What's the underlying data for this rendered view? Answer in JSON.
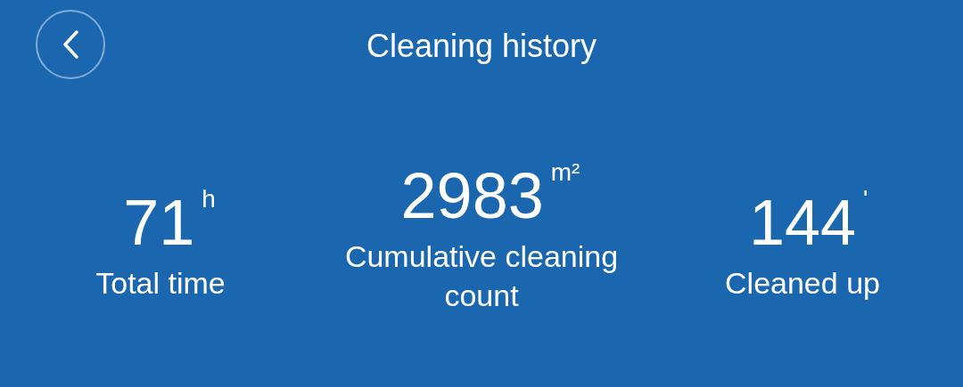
{
  "header": {
    "title": "Cleaning history"
  },
  "stats": [
    {
      "value": "71",
      "unit": "h",
      "label": "Total time"
    },
    {
      "value": "2983",
      "unit": "m²",
      "label": "Cumulative cleaning count"
    },
    {
      "value": "144",
      "unit": "'",
      "label": "Cleaned up"
    }
  ]
}
